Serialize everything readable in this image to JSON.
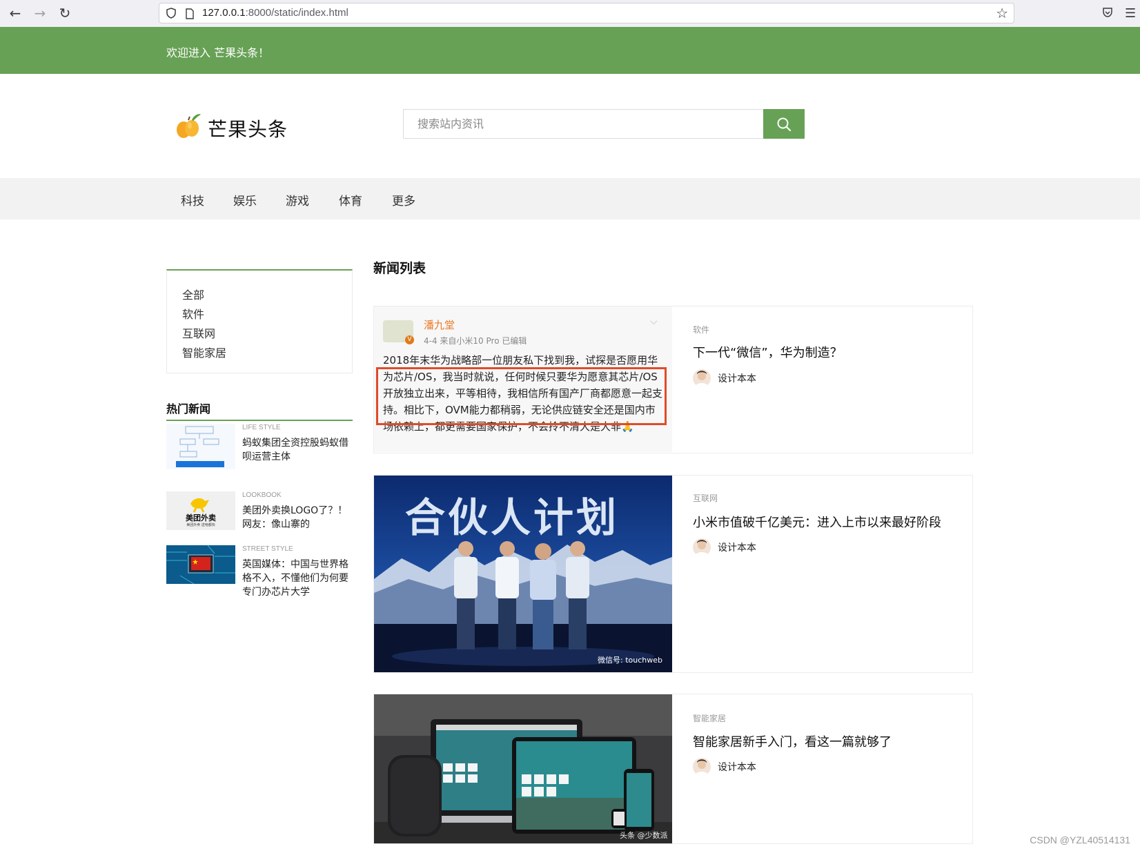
{
  "browser": {
    "url_host": "127.0.0.1",
    "url_rest": ":8000/static/index.html"
  },
  "top_bar": {
    "welcome": "欢迎进入 芒果头条！"
  },
  "header": {
    "site_name": "芒果头条",
    "search_placeholder": "搜索站内资讯"
  },
  "nav": {
    "items": [
      "科技",
      "娱乐",
      "游戏",
      "体育",
      "更多"
    ]
  },
  "sidebar": {
    "categories": [
      "全部",
      "软件",
      "互联网",
      "智能家居"
    ],
    "hot_title": "热门新闻",
    "hot_news": [
      {
        "tag": "LIFE STYLE",
        "title": "蚂蚁集团全资控股蚂蚁借呗运营主体"
      },
      {
        "tag": "LOOKBOOK",
        "title": "美团外卖换LOGO了？！网友：像山寨的",
        "logo_text": "美团外卖",
        "logo_sub": "美团外卖 送啥都快"
      },
      {
        "tag": "STREET STYLE",
        "title": "英国媒体：中国与世界格格不入，不懂他们为何要专门办芯片大学"
      }
    ]
  },
  "main": {
    "list_title": "新闻列表",
    "news": [
      {
        "category": "软件",
        "title": "下一代“微信”，华为制造？",
        "author": "设计本本",
        "image": {
          "weibo_name": "潘九堂",
          "weibo_meta": "4-4  来自小米10 Pro  已编辑",
          "weibo_text": "2018年末华为战略部一位朋友私下找到我，试探是否愿用华为芯片/OS，我当时就说，任何时候只要华为愿意其芯片/OS开放独立出来，平等相待，我相信所有国产厂商都愿意一起支持。相比下，OVM能力都稍弱，无论供应链安全还是国内市场依赖上，都更需要国家保护，不会拎不清大是大非🙏"
        }
      },
      {
        "category": "互联网",
        "title": "小米市值破千亿美元：进入上市以来最好阶段",
        "author": "设计本本",
        "image": {
          "banner": "合伙人计划",
          "wechat_mark": "微信号: touchweb"
        }
      },
      {
        "category": "智能家居",
        "title": "智能家居新手入门，看这一篇就够了",
        "author": "设计本本",
        "image": {
          "mark": "头条 @少数派"
        }
      }
    ]
  },
  "watermark": "CSDN @YZL40514131",
  "colors": {
    "brand_green": "#67a155",
    "highlight_red": "#e04b2a"
  }
}
